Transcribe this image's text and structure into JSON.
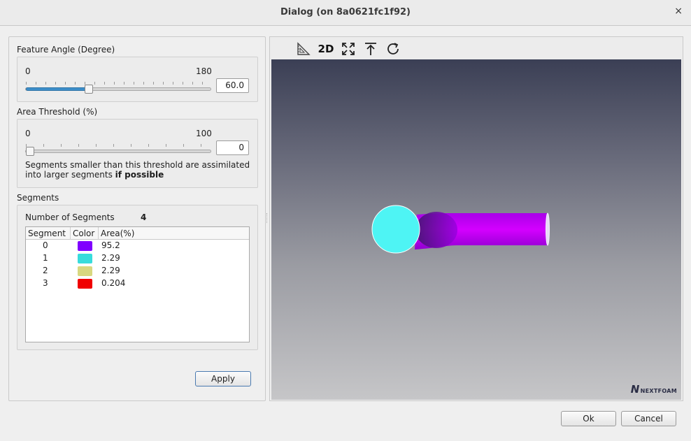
{
  "window": {
    "title": "Dialog (on 8a0621fc1f92)",
    "close_glyph": "×"
  },
  "feature_angle": {
    "label": "Feature Angle (Degree)",
    "min_label": "0",
    "max_label": "180",
    "value": "60.0",
    "slider_fraction": 0.333
  },
  "area_threshold": {
    "label": "Area Threshold (%)",
    "min_label": "0",
    "max_label": "100",
    "value": "0",
    "slider_fraction": 0.0,
    "help_text": "Segments smaller than this threshold are assimilated into larger segments ",
    "help_bold": "if possible"
  },
  "segments": {
    "label": "Segments",
    "count_label": "Number of Segments",
    "count": "4",
    "columns": [
      "Segment",
      "Color",
      "Area(%)"
    ],
    "rows": [
      {
        "segment": "0",
        "color": "#8000ff",
        "area": "95.2"
      },
      {
        "segment": "1",
        "color": "#38dcdc",
        "area": "2.29"
      },
      {
        "segment": "2",
        "color": "#d8d880",
        "area": "2.29"
      },
      {
        "segment": "3",
        "color": "#f00000",
        "area": "0.204"
      }
    ]
  },
  "buttons": {
    "apply": "Apply",
    "ok": "Ok",
    "cancel": "Cancel"
  },
  "toolbar": {
    "icons": [
      "ruler-icon",
      "2d-view-icon",
      "fit-view-icon",
      "align-top-icon",
      "reset-rotate-icon"
    ],
    "label_2d": "2D"
  },
  "viewport": {
    "logo_mark": "N",
    "logo_text": "NEXTFOAM",
    "colors": {
      "cylinder": "#c000f0",
      "cap": "#4ef4f4",
      "background_top": "#3b3f55",
      "background_bottom": "#c6c6c8"
    }
  }
}
